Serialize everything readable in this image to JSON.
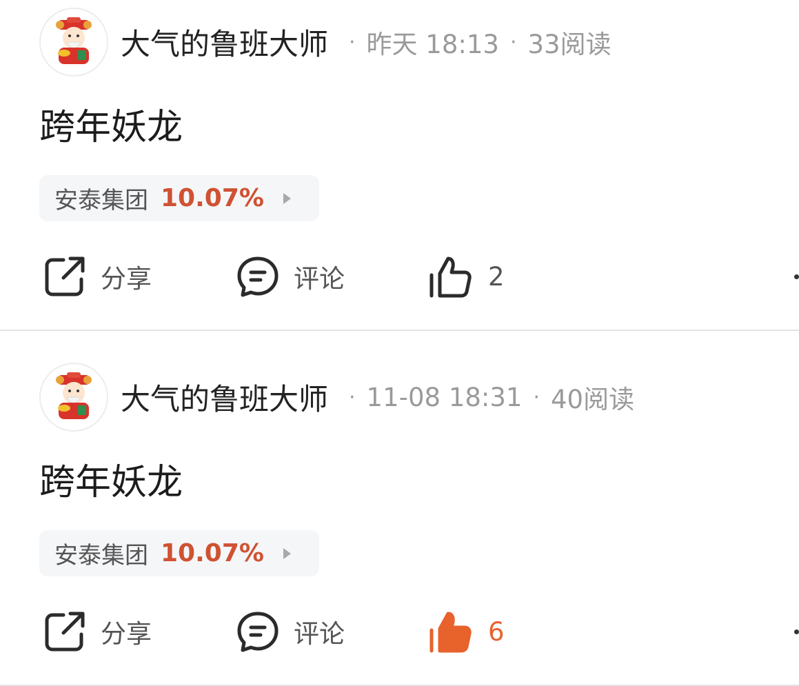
{
  "posts": [
    {
      "author": "大气的鲁班大师",
      "time": "昨天 18:13",
      "reads": "33阅读",
      "title": "跨年妖龙",
      "stock": {
        "name": "安泰集团",
        "change": "10.07%"
      },
      "actions": {
        "share_label": "分享",
        "comment_label": "评论",
        "like_count": "2",
        "liked": false
      }
    },
    {
      "author": "大气的鲁班大师",
      "time": "11-08 18:31",
      "reads": "40阅读",
      "title": "跨年妖龙",
      "stock": {
        "name": "安泰集团",
        "change": "10.07%"
      },
      "actions": {
        "share_label": "分享",
        "comment_label": "评论",
        "like_count": "6",
        "liked": true
      }
    }
  ],
  "colors": {
    "accent": "#e8622c",
    "stock_up": "#cf5233",
    "meta_gray": "#9a9a9a",
    "chip_bg": "#f5f6f8"
  },
  "icons": {
    "share": "share-icon",
    "comment": "comment-icon",
    "like": "thumbs-up-icon",
    "avatar": "caishen-avatar-icon"
  }
}
